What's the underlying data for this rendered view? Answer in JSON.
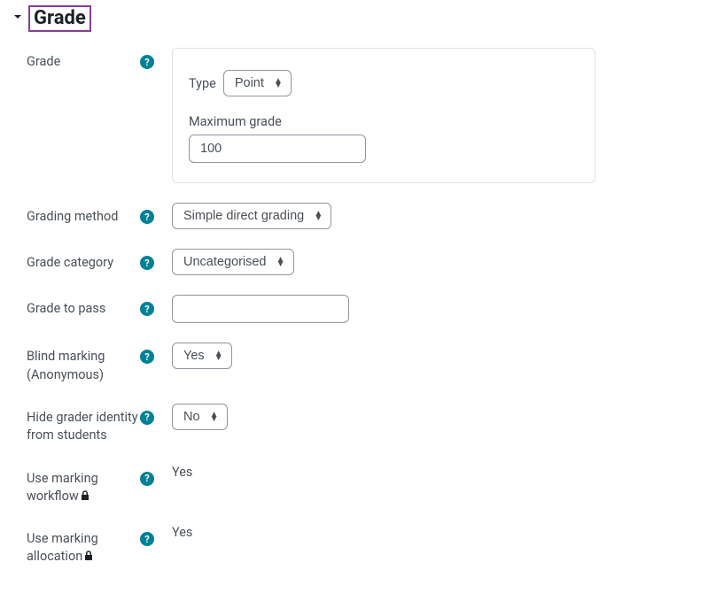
{
  "section": {
    "title": "Grade"
  },
  "fields": {
    "grade": {
      "label": "Grade",
      "type_label": "Type",
      "type_value": "Point",
      "max_label": "Maximum grade",
      "max_value": "100"
    },
    "grading_method": {
      "label": "Grading method",
      "value": "Simple direct grading"
    },
    "grade_category": {
      "label": "Grade category",
      "value": "Uncategorised"
    },
    "grade_to_pass": {
      "label": "Grade to pass",
      "value": ""
    },
    "blind_marking": {
      "label": "Blind marking (Anonymous)",
      "value": "Yes"
    },
    "hide_grader": {
      "label": "Hide grader identity from students",
      "value": "No"
    },
    "marking_workflow": {
      "label": "Use marking workflow",
      "value": "Yes"
    },
    "marking_allocation": {
      "label": "Use marking allocation",
      "value": "Yes"
    }
  }
}
